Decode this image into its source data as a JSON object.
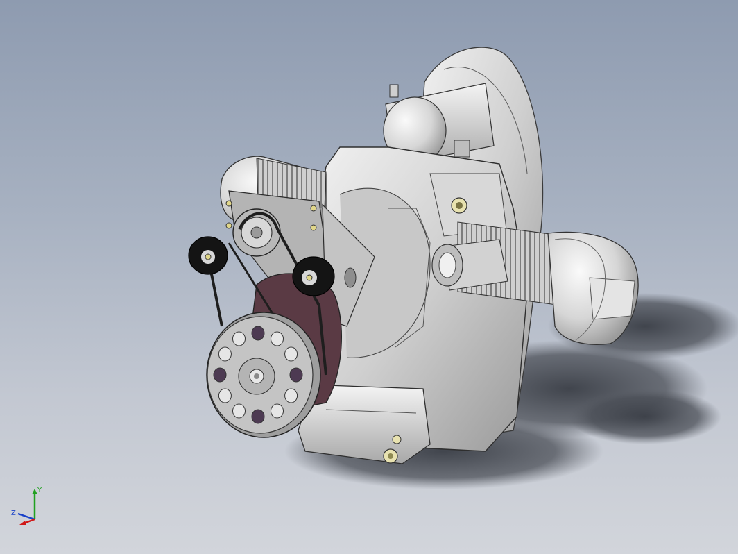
{
  "viewport": {
    "background_top": "#8e9bb0",
    "background_bottom": "#d2d5db",
    "model_description": "boxer-engine-assembly"
  },
  "triad": {
    "x_color": "#d01818",
    "y_color": "#20a020",
    "z_color": "#1840c8",
    "y_label": "Y",
    "z_label": "Z"
  }
}
